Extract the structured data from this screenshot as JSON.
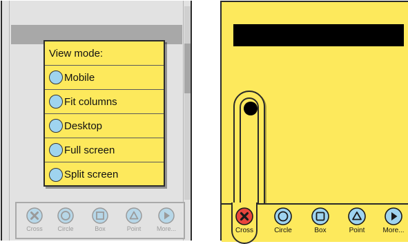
{
  "left_screen": {
    "popup": {
      "title": "View mode:",
      "options": [
        {
          "label": "Mobile"
        },
        {
          "label": "Fit columns"
        },
        {
          "label": "Desktop"
        },
        {
          "label": "Full screen"
        },
        {
          "label": "Split screen"
        }
      ]
    },
    "toolbar": [
      {
        "label": "Cross",
        "icon": "cross-icon"
      },
      {
        "label": "Circle",
        "icon": "circle-icon"
      },
      {
        "label": "Box",
        "icon": "box-icon"
      },
      {
        "label": "Point",
        "icon": "point-icon"
      },
      {
        "label": "More...",
        "icon": "more-icon"
      }
    ]
  },
  "right_screen": {
    "toolbar": [
      {
        "label": "Cross",
        "icon": "cross-icon",
        "selected": true
      },
      {
        "label": "Circle",
        "icon": "circle-icon"
      },
      {
        "label": "Box",
        "icon": "box-icon"
      },
      {
        "label": "Point",
        "icon": "point-icon"
      },
      {
        "label": "More...",
        "icon": "more-icon"
      }
    ],
    "slider_value": 1.0
  },
  "colors": {
    "popup_bg": "#fde95c",
    "radio_fill": "#9fd4ef",
    "cross_selected": "#e8453c",
    "icon_blue": "#9fd4ef",
    "left_bg": "#e2e2e2"
  }
}
